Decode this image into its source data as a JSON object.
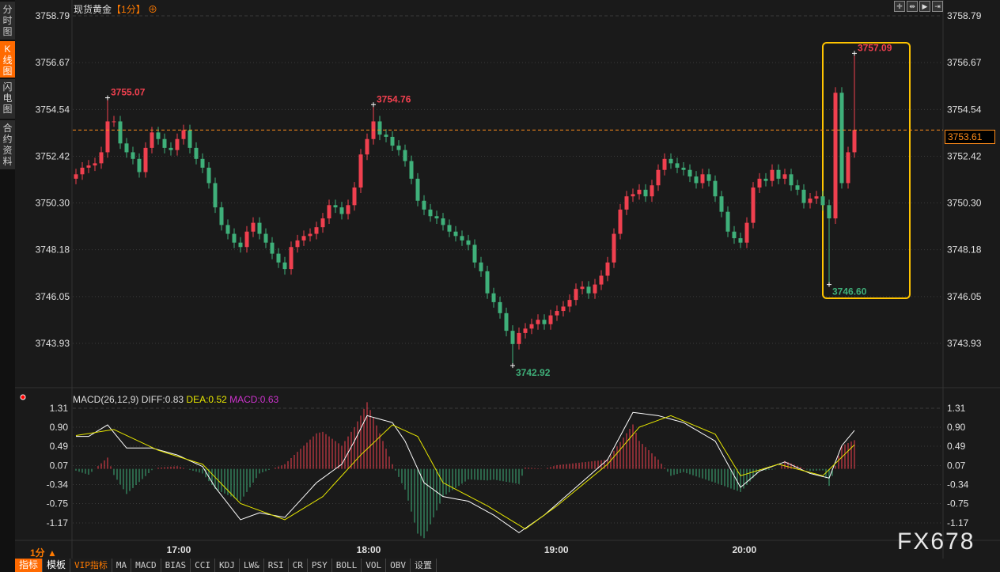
{
  "sidebar": {
    "tabs": [
      {
        "label": "分时图",
        "active": false
      },
      {
        "label": "K线图",
        "active": true
      },
      {
        "label": "闪电图",
        "active": false
      },
      {
        "label": "合约资料",
        "active": false
      }
    ]
  },
  "header": {
    "symbol": "现货黄金",
    "timeframe": "【1分】",
    "tool_icons": [
      "crosshair-icon",
      "zoom-range-icon",
      "play-range-icon",
      "jump-end-icon"
    ]
  },
  "colors": {
    "up": "#f0404f",
    "down": "#3fb07a",
    "accent": "#ff6a00",
    "last_price": "#ff8c1a",
    "highlight_box": "#ffc400",
    "dea": "#e6e600",
    "macd": "#cc33cc"
  },
  "chart_data": {
    "type": "candlestick",
    "timeframe": "1分",
    "y_ticks": [
      "3758.79",
      "3756.67",
      "3754.54",
      "3752.42",
      "3750.30",
      "3748.18",
      "3746.05",
      "3743.93"
    ],
    "ylim": [
      3743.93,
      3758.79
    ],
    "x_ticks": [
      {
        "label": "17:00",
        "index": 16.25
      },
      {
        "label": "18:00",
        "index": 46.25
      },
      {
        "label": "19:00",
        "index": 75.9
      },
      {
        "label": "20:00",
        "index": 105.6
      }
    ],
    "last_price": "3753.61",
    "closes": [
      3751.6,
      3751.9,
      3752.0,
      3752.1,
      3752.6,
      3754.0,
      3754.0,
      3753.0,
      3752.6,
      3752.3,
      3751.7,
      3752.8,
      3753.5,
      3753.2,
      3752.8,
      3752.7,
      3753.2,
      3753.6,
      3752.8,
      3752.3,
      3751.9,
      3751.2,
      3750.1,
      3749.3,
      3748.9,
      3748.5,
      3748.3,
      3749.0,
      3749.4,
      3748.9,
      3748.5,
      3748.0,
      3747.6,
      3747.3,
      3748.3,
      3748.6,
      3748.8,
      3748.9,
      3749.2,
      3749.6,
      3750.2,
      3750.1,
      3749.8,
      3750.2,
      3751.0,
      3752.5,
      3753.2,
      3754.0,
      3753.4,
      3753.3,
      3752.9,
      3752.7,
      3752.2,
      3751.4,
      3750.4,
      3750.0,
      3749.7,
      3749.6,
      3749.3,
      3749.0,
      3748.8,
      3748.6,
      3748.4,
      3747.6,
      3747.2,
      3746.2,
      3745.8,
      3745.3,
      3744.5,
      3743.9,
      3744.4,
      3744.6,
      3744.8,
      3745.0,
      3744.8,
      3745.2,
      3745.4,
      3745.6,
      3745.9,
      3746.4,
      3746.5,
      3746.2,
      3746.6,
      3747.0,
      3747.6,
      3748.9,
      3750.0,
      3750.6,
      3750.7,
      3750.9,
      3750.6,
      3751.1,
      3751.8,
      3752.3,
      3752.1,
      3751.9,
      3751.8,
      3751.5,
      3751.2,
      3751.6,
      3751.3,
      3750.6,
      3749.9,
      3749.0,
      3748.7,
      3748.5,
      3749.4,
      3751.0,
      3751.4,
      3751.3,
      3751.8,
      3751.4,
      3751.6,
      3751.1,
      3750.9,
      3750.3,
      3750.5,
      3750.6,
      3750.2,
      3749.6,
      3755.3,
      3751.2,
      3752.6,
      3753.61
    ],
    "extremes": [
      {
        "type": "high",
        "index": 5,
        "value": 3755.07,
        "label": "3755.07"
      },
      {
        "type": "high",
        "index": 47,
        "value": 3754.76,
        "label": "3754.76"
      },
      {
        "type": "low",
        "index": 69,
        "value": 3742.92,
        "label": "3742.92"
      },
      {
        "type": "low",
        "index": 119,
        "value": 3746.6,
        "label": "3746.60"
      },
      {
        "type": "high",
        "index": 123,
        "value": 3757.09,
        "label": "3757.09"
      }
    ],
    "highlight_range": [
      119,
      123
    ],
    "macd": {
      "label": "MACD(26,12,9)",
      "diff_label": "DIFF:0.83",
      "dea_label": "DEA:0.52",
      "macd_label": "MACD:0.63",
      "y_ticks": [
        "1.31",
        "0.90",
        "0.49",
        "0.07",
        "-0.34",
        "-0.75",
        "-1.17"
      ],
      "ylim": [
        -1.17,
        1.31
      ],
      "diff": [
        [
          0,
          0.7
        ],
        [
          2,
          0.7
        ],
        [
          5,
          0.95
        ],
        [
          8,
          0.45
        ],
        [
          12,
          0.45
        ],
        [
          16,
          0.3
        ],
        [
          20,
          0.05
        ],
        [
          22,
          -0.4
        ],
        [
          26,
          -1.1
        ],
        [
          29,
          -0.95
        ],
        [
          33,
          -1.05
        ],
        [
          36,
          -0.6
        ],
        [
          38,
          -0.3
        ],
        [
          42,
          0.1
        ],
        [
          44,
          0.6
        ],
        [
          46,
          1.15
        ],
        [
          50,
          1.0
        ],
        [
          52,
          0.6
        ],
        [
          55,
          -0.3
        ],
        [
          58,
          -0.6
        ],
        [
          62,
          -0.7
        ],
        [
          66,
          -1.0
        ],
        [
          70,
          -1.38
        ],
        [
          74,
          -1.0
        ],
        [
          79,
          -0.4
        ],
        [
          84,
          0.2
        ],
        [
          88,
          1.22
        ],
        [
          92,
          1.15
        ],
        [
          96,
          1.0
        ],
        [
          101,
          0.6
        ],
        [
          105,
          -0.4
        ],
        [
          108,
          -0.05
        ],
        [
          112,
          0.15
        ],
        [
          116,
          -0.1
        ],
        [
          119,
          -0.2
        ],
        [
          121,
          0.5
        ],
        [
          123,
          0.83
        ]
      ],
      "dea": [
        [
          0,
          0.72
        ],
        [
          6,
          0.85
        ],
        [
          13,
          0.4
        ],
        [
          20,
          0.1
        ],
        [
          26,
          -0.75
        ],
        [
          33,
          -1.1
        ],
        [
          39,
          -0.6
        ],
        [
          45,
          0.3
        ],
        [
          50,
          0.95
        ],
        [
          54,
          0.7
        ],
        [
          58,
          -0.3
        ],
        [
          65,
          -0.8
        ],
        [
          71,
          -1.3
        ],
        [
          76,
          -0.8
        ],
        [
          84,
          0.1
        ],
        [
          89,
          0.9
        ],
        [
          94,
          1.15
        ],
        [
          101,
          0.75
        ],
        [
          105,
          -0.15
        ],
        [
          111,
          0.1
        ],
        [
          118,
          -0.15
        ],
        [
          123,
          0.52
        ]
      ]
    }
  },
  "bottom": {
    "period": "1分 ▲",
    "tabs": [
      "指标",
      "模板",
      "VIP指标",
      "MA",
      "MACD",
      "BIAS",
      "CCI",
      "KDJ",
      "LW&",
      "RSI",
      "CR",
      "PSY",
      "BOLL",
      "VOL",
      "OBV",
      "设置"
    ]
  },
  "watermark": "FX678"
}
